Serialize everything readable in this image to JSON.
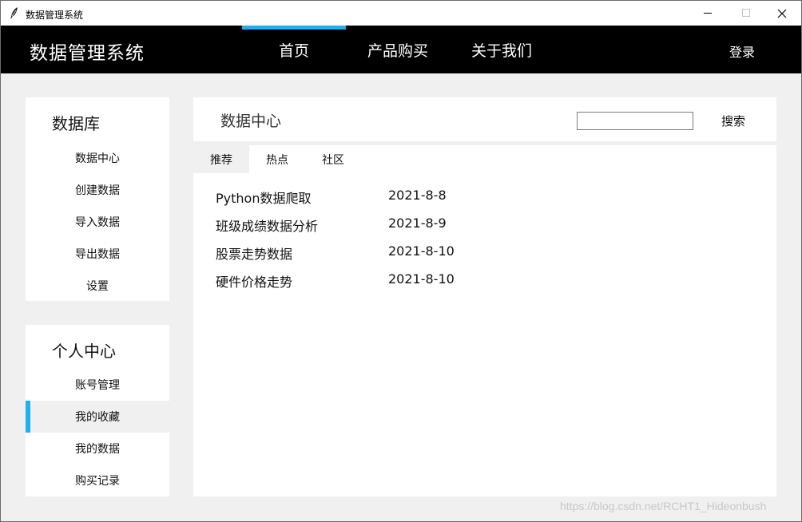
{
  "window": {
    "title": "数据管理系统",
    "icon": "feather-icon"
  },
  "navbar": {
    "brand": "数据管理系统",
    "items": [
      {
        "label": "首页",
        "active": true
      },
      {
        "label": "产品购买",
        "active": false
      },
      {
        "label": "关于我们",
        "active": false
      }
    ],
    "login_label": "登录",
    "accent_color": "#1eb0f2"
  },
  "sidebar": {
    "database": {
      "title": "数据库",
      "items": [
        "数据中心",
        "创建数据",
        "导入数据",
        "导出数据",
        "设置"
      ]
    },
    "personal": {
      "title": "个人中心",
      "items": [
        "账号管理",
        "我的收藏",
        "我的数据",
        "购买记录"
      ],
      "selected_index": 1
    }
  },
  "main": {
    "title": "数据中心",
    "search": {
      "value": "",
      "button_label": "搜索"
    },
    "tabs": [
      "推荐",
      "热点",
      "社区"
    ],
    "active_tab": 0,
    "rows": [
      {
        "name": "Python数据爬取",
        "date": "2021-8-8"
      },
      {
        "name": "班级成绩数据分析",
        "date": "2021-8-9"
      },
      {
        "name": "股票走势数据",
        "date": "2021-8-10"
      },
      {
        "name": "硬件价格走势",
        "date": "2021-8-10"
      }
    ]
  },
  "watermark": "https://blog.csdn.net/RCHT1_Hideonbush"
}
